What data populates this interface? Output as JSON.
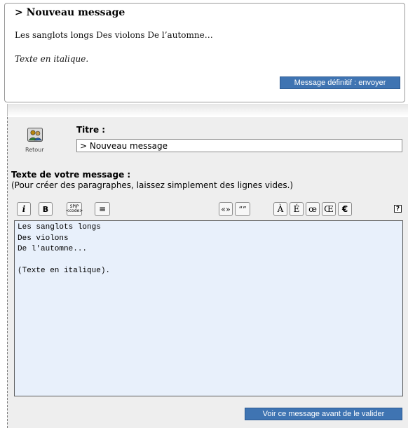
{
  "preview": {
    "title": "> Nouveau message",
    "line1": "Les sanglots longs Des violons De l’automne…",
    "line2": "Texte en italique.",
    "send_button": "Message définitif : envoyer"
  },
  "form": {
    "back_label": "Retour",
    "titre_label": "Titre :",
    "titre_value": "> Nouveau message",
    "texte_label": "Texte de votre message :",
    "texte_hint": "(Pour créer des paragraphes, laissez simplement des lignes vides.)",
    "message_value": "Les sanglots longs\nDes violons\nDe l'automne...\n\n(Texte en italique).",
    "preview_button": "Voir ce message avant de le valider"
  },
  "toolbar": {
    "italic": "i",
    "bold": "B",
    "code_top": "SPIP",
    "code_bottom": "<code>",
    "paragraph": "≡",
    "french_quotes": "«»",
    "english_quotes": "“”",
    "a_grave": "À",
    "e_acute": "É",
    "oe": "œ",
    "OE": "Œ",
    "euro": "€",
    "help": "?"
  },
  "icons": {
    "back": "users-icon",
    "help": "help-icon"
  },
  "colors": {
    "button_blue": "#3f74b2",
    "textarea_bg": "#e8f0fb",
    "panel_bg": "#eeeeee"
  }
}
